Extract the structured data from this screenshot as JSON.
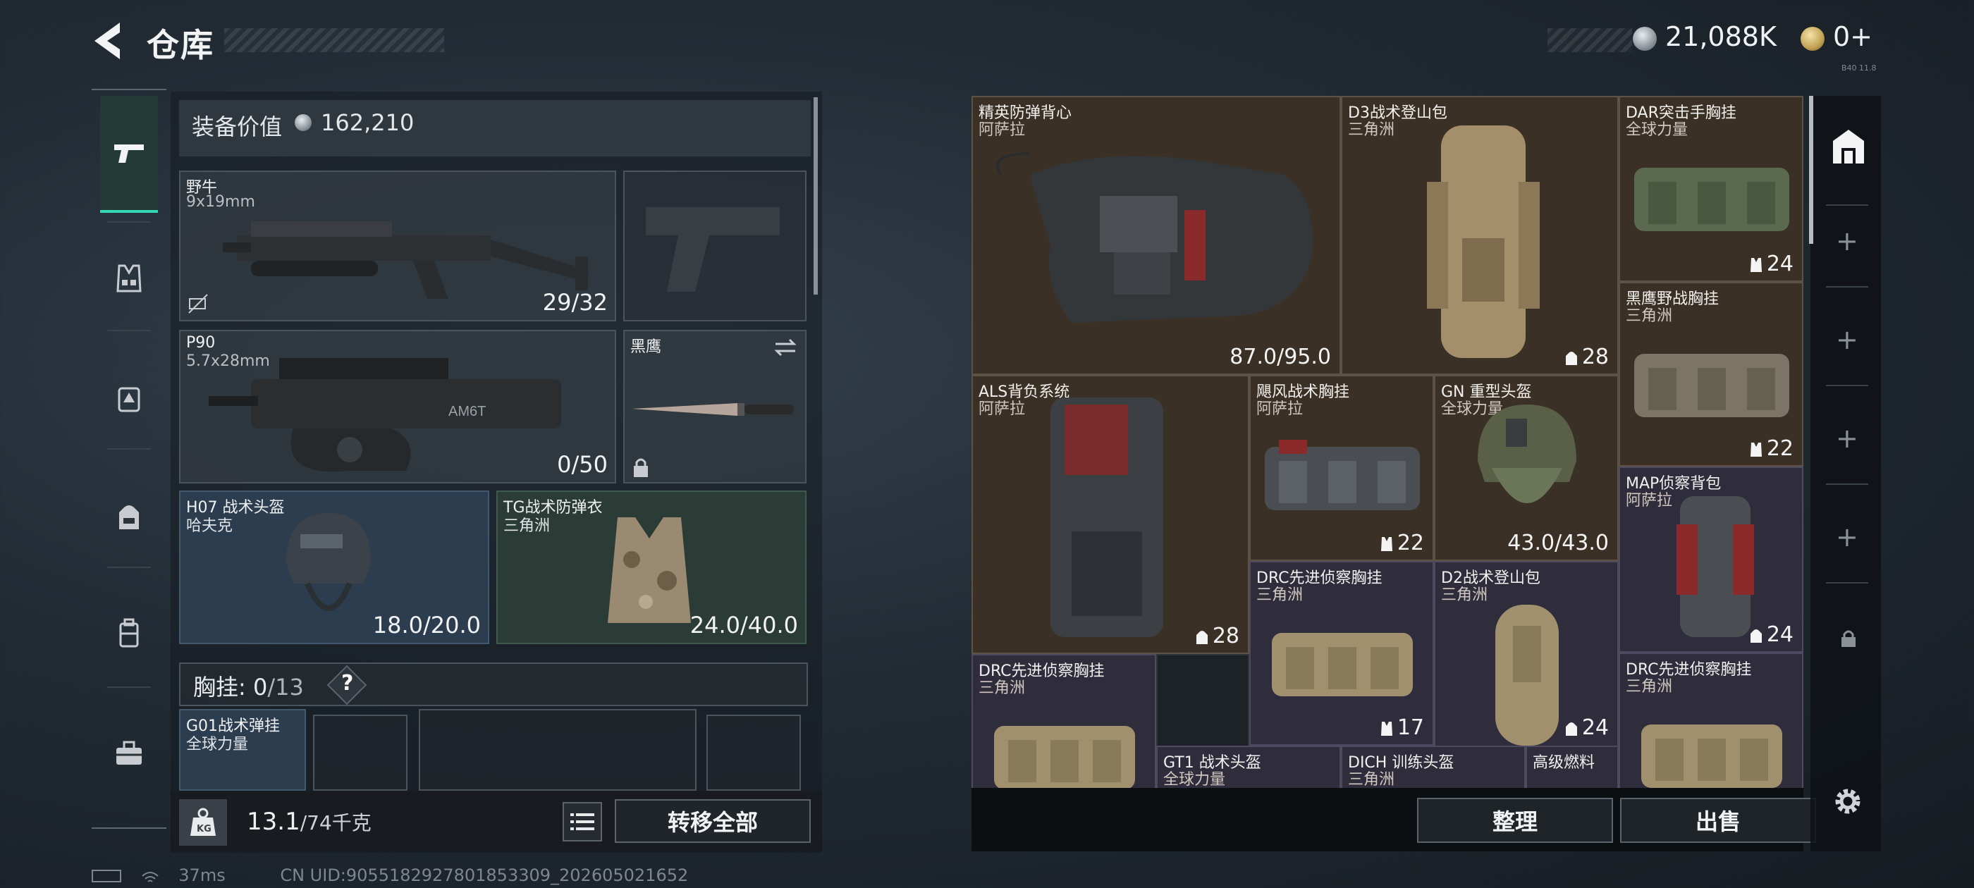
{
  "header": {
    "title": "仓库",
    "silver_amount": "21,088K",
    "gold_amount": "0+",
    "version_text": "B40 11.8"
  },
  "sidebar": {
    "items": [
      {
        "name": "pistol",
        "active": true
      },
      {
        "name": "armor-vest",
        "active": false
      },
      {
        "name": "backpack-slot",
        "active": false
      },
      {
        "name": "backpack",
        "active": false
      },
      {
        "name": "case",
        "active": false
      },
      {
        "name": "toolbox",
        "active": false
      }
    ]
  },
  "loadout": {
    "equip_label": "装备价值",
    "equip_value": "162,210",
    "primary": {
      "name": "野牛",
      "caliber": "9x19mm",
      "ammo": "29/32"
    },
    "secondary": {
      "name": "P90",
      "caliber": "5.7x28mm",
      "ammo": "0/50"
    },
    "melee": {
      "name": "黑鹰"
    },
    "helmet": {
      "name": "H07 战术头盔",
      "maker": "哈夫克",
      "durability": "18.0/20.0"
    },
    "armor": {
      "name": "TG战术防弹衣",
      "maker": "三角洲",
      "durability": "24.0/40.0"
    },
    "chest": {
      "label": "胸挂:",
      "current": "0",
      "max": "/13",
      "help": "?"
    },
    "chest_item": {
      "name": "G01战术弹挂",
      "maker": "全球力量"
    },
    "weight": {
      "current": "13.1",
      "max": "/74千克"
    },
    "transfer_label": "转移全部"
  },
  "storage": {
    "items": [
      {
        "name": "精英防弹背心",
        "maker": "阿萨拉",
        "value": "87.0/95.0"
      },
      {
        "name": "D3战术登山包",
        "maker": "三角洲",
        "value": "28"
      },
      {
        "name": "DAR突击手胸挂",
        "maker": "全球力量",
        "value": "24"
      },
      {
        "name": "黑鹰野战胸挂",
        "maker": "三角洲",
        "value": "22"
      },
      {
        "name": "ALS背负系统",
        "maker": "阿萨拉",
        "value": "28"
      },
      {
        "name": "飓风战术胸挂",
        "maker": "阿萨拉",
        "value": "22"
      },
      {
        "name": "GN 重型头盔",
        "maker": "全球力量",
        "value": "43.0/43.0"
      },
      {
        "name": "MAP侦察背包",
        "maker": "阿萨拉",
        "value": "24"
      },
      {
        "name": "DRC先进侦察胸挂",
        "maker": "三角洲",
        "value": "17"
      },
      {
        "name": "D2战术登山包",
        "maker": "三角洲",
        "value": "24"
      },
      {
        "name": "DRC先进侦察胸挂",
        "maker": "三角洲",
        "value": ""
      },
      {
        "name": "DRC先进侦察胸挂",
        "maker": "三角洲",
        "value": ""
      },
      {
        "name": "GT1 战术头盔",
        "maker": "全球力量",
        "value": ""
      },
      {
        "name": "DICH 训练头盔",
        "maker": "三角洲",
        "value": ""
      },
      {
        "name": "高级燃料",
        "maker": "",
        "value": ""
      }
    ],
    "tidy_label": "整理",
    "sell_label": "出售"
  },
  "status": {
    "ping": "37ms",
    "uid": "CN UID:9055182927801853309_202605021652"
  },
  "colors": {
    "accent": "#35d8b4",
    "item_brown": "#3b3026",
    "item_purple": "#2f2d3c",
    "slot_blue": "#2b3d4f",
    "slot_green": "#2a3c35"
  }
}
